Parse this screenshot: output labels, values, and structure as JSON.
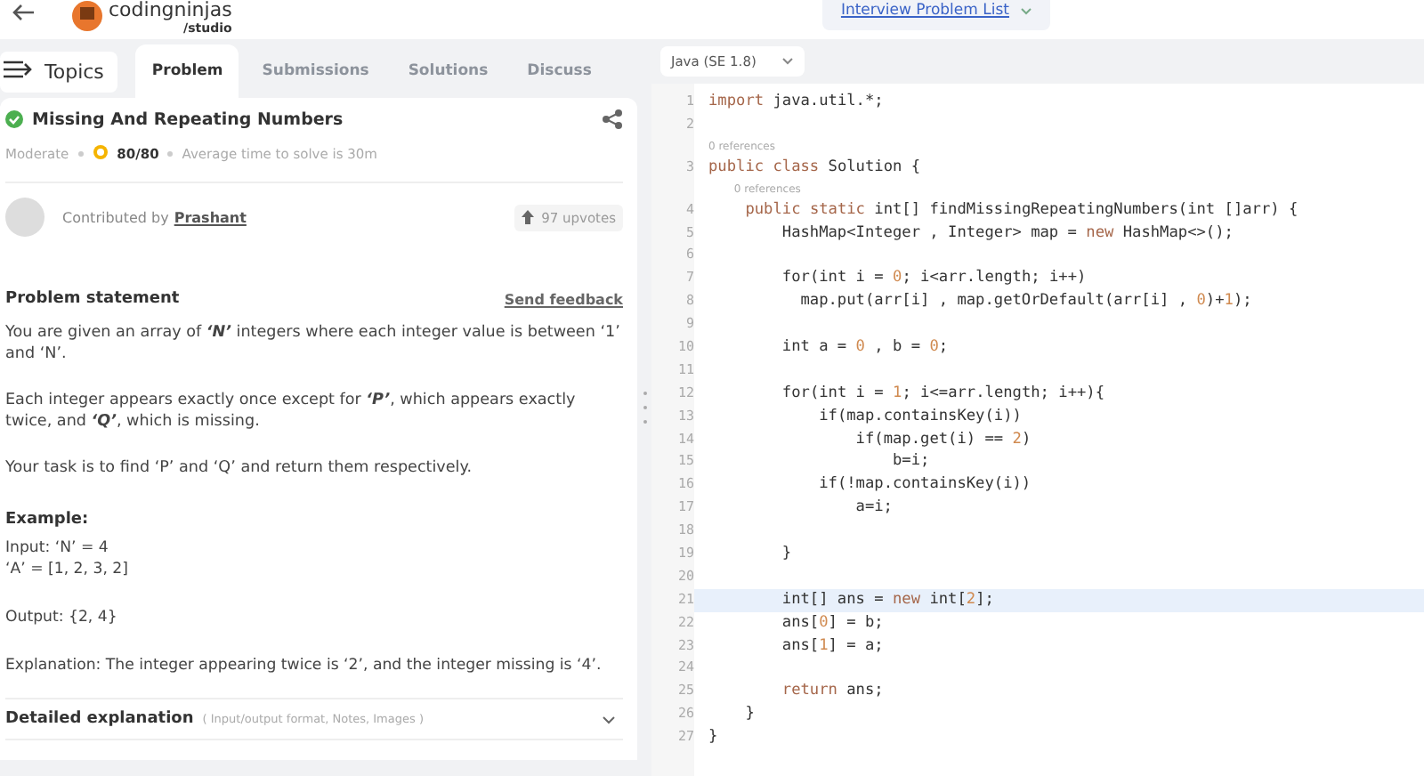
{
  "header": {
    "logo_text": "codingninjas",
    "logo_sub": "/studio",
    "problem_list": "Interview Problem List"
  },
  "tabs": [
    {
      "label": "Topics",
      "kind": "menu",
      "selected": false
    },
    {
      "label": "Problem",
      "kind": "tab",
      "selected": true
    },
    {
      "label": "Submissions",
      "kind": "tab",
      "selected": false
    },
    {
      "label": "Solutions",
      "kind": "tab",
      "selected": false
    },
    {
      "label": "Discuss",
      "kind": "tab",
      "selected": false
    }
  ],
  "problem": {
    "title": "Missing And Repeating Numbers",
    "solved": true,
    "difficulty": "Moderate",
    "score": "80/80",
    "avg_time": "Average time to solve is 30m",
    "contributed_by": "Contributed by",
    "author": "Prashant",
    "upvotes": "97 upvotes",
    "statement_title": "Problem statement",
    "feedback": "Send feedback",
    "paragraphs": [
      "You are given an array of **‘N’** integers where each integer value is between ‘1’ and ‘N’.",
      "Each integer appears exactly once except for **‘P’**, which appears exactly twice, and **‘Q’**, which is missing.",
      "Your task is to find ‘P’ and ‘Q’ and return them respectively."
    ],
    "example_title": "Example:",
    "example_blocks": [
      [
        "Input: ‘N’ = 4",
        "‘A’ = [1, 2, 3, 2]"
      ],
      [
        "Output: {2, 4}"
      ],
      [
        "Explanation: The integer appearing twice is ‘2’, and the integer missing is ‘4’."
      ]
    ],
    "detailed": "Detailed explanation",
    "detailed_hint": "( Input/output format, Notes, Images )",
    "expanded": false
  },
  "editor": {
    "language": "Java (SE 1.8)",
    "lines": [
      {
        "number": "1",
        "text": "import java.util.*;",
        "highlighted": false
      },
      {
        "number": "2",
        "highlighted": false
      },
      {
        "number": "3",
        "references": "0 references",
        "text": "public class Solution {",
        "highlighted": false
      },
      {
        "number": "4",
        "references": "0 references",
        "text": "    public static int[] findMissingRepeatingNumbers(int []arr) {",
        "highlighted": false
      },
      {
        "number": "5",
        "text": "        HashMap<Integer , Integer> map = new HashMap<>();",
        "highlighted": false
      },
      {
        "number": "6",
        "highlighted": false
      },
      {
        "number": "7",
        "text": "        for(int i = 0; i<arr.length; i++)",
        "highlighted": false
      },
      {
        "number": "8",
        "text": "          map.put(arr[i] , map.getOrDefault(arr[i] , 0)+1);",
        "highlighted": false
      },
      {
        "number": "9",
        "highlighted": false
      },
      {
        "number": "10",
        "text": "        int a = 0 , b = 0;",
        "highlighted": false
      },
      {
        "number": "11",
        "highlighted": false
      },
      {
        "number": "12",
        "text": "        for(int i = 1; i<=arr.length; i++){",
        "highlighted": false
      },
      {
        "number": "13",
        "text": "            if(map.containsKey(i))",
        "highlighted": false
      },
      {
        "number": "14",
        "text": "                if(map.get(i) == 2)",
        "highlighted": false
      },
      {
        "number": "15",
        "text": "                    b=i;",
        "highlighted": false
      },
      {
        "number": "16",
        "text": "            if(!map.containsKey(i))",
        "highlighted": false
      },
      {
        "number": "17",
        "text": "                a=i;",
        "highlighted": false
      },
      {
        "number": "18",
        "highlighted": false
      },
      {
        "number": "19",
        "text": "        }",
        "highlighted": false
      },
      {
        "number": "20",
        "highlighted": false
      },
      {
        "number": "21",
        "text": "        int[] ans = new int[2];",
        "highlighted": true
      },
      {
        "number": "22",
        "text": "        ans[0] = b;",
        "highlighted": false
      },
      {
        "number": "23",
        "text": "        ans[1] = a;",
        "highlighted": false
      },
      {
        "number": "24",
        "highlighted": false
      },
      {
        "number": "25",
        "text": "        return ans;",
        "highlighted": false
      },
      {
        "number": "26",
        "text": "    }",
        "highlighted": false
      },
      {
        "number": "27",
        "text": "}",
        "highlighted": false
      }
    ]
  }
}
